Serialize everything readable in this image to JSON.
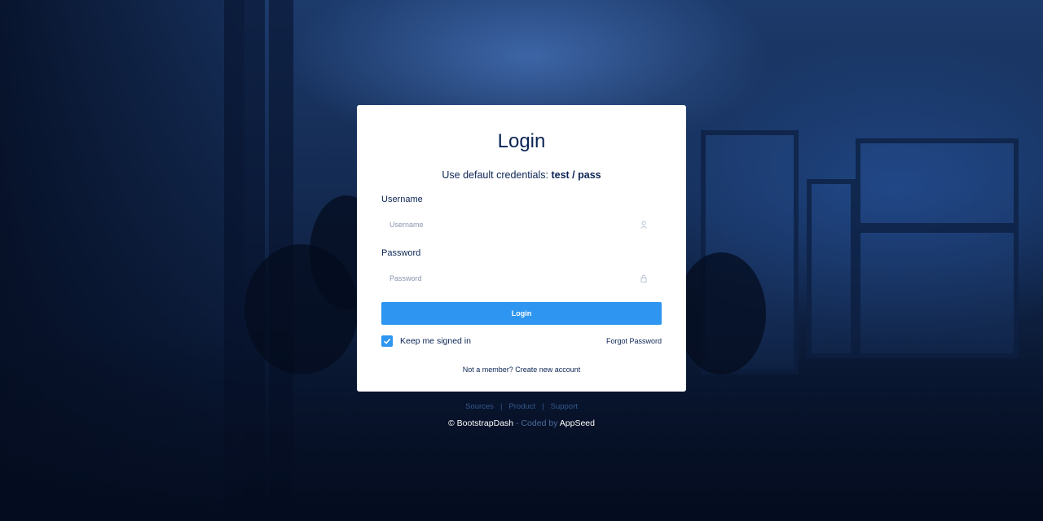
{
  "login": {
    "title": "Login",
    "subtitle_prefix": "Use default credentials: ",
    "credentials": "test / pass",
    "username_label": "Username",
    "username_placeholder": "Username",
    "password_label": "Password",
    "password_placeholder": "Password",
    "submit_label": "Login",
    "remember_label": "Keep me signed in",
    "remember_checked": true,
    "forgot_label": "Forgot Password",
    "signup_prefix": "Not a member? ",
    "signup_link": "Create new account"
  },
  "footer": {
    "links": [
      "Sources",
      "Product",
      "Support"
    ],
    "copyright_symbol": "©",
    "brand": "BootstrapDash",
    "coded_by": " - Coded by ",
    "author": "AppSeed"
  },
  "icons": {
    "user_field": "user-icon",
    "password_field": "lock-icon",
    "checkbox": "check-icon"
  },
  "colors": {
    "primary": "#2e96f0",
    "text": "#0b2454",
    "background": "#13294f"
  }
}
